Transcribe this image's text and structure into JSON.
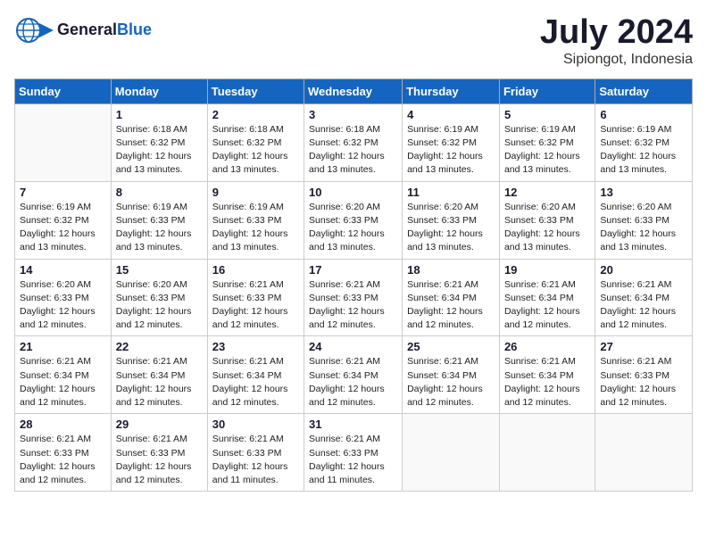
{
  "header": {
    "logo_general": "General",
    "logo_blue": "Blue",
    "month_year": "July 2024",
    "location": "Sipiongot, Indonesia"
  },
  "days_of_week": [
    "Sunday",
    "Monday",
    "Tuesday",
    "Wednesday",
    "Thursday",
    "Friday",
    "Saturday"
  ],
  "weeks": [
    [
      {
        "day": "",
        "info": ""
      },
      {
        "day": "1",
        "info": "Sunrise: 6:18 AM\nSunset: 6:32 PM\nDaylight: 12 hours\nand 13 minutes."
      },
      {
        "day": "2",
        "info": "Sunrise: 6:18 AM\nSunset: 6:32 PM\nDaylight: 12 hours\nand 13 minutes."
      },
      {
        "day": "3",
        "info": "Sunrise: 6:18 AM\nSunset: 6:32 PM\nDaylight: 12 hours\nand 13 minutes."
      },
      {
        "day": "4",
        "info": "Sunrise: 6:19 AM\nSunset: 6:32 PM\nDaylight: 12 hours\nand 13 minutes."
      },
      {
        "day": "5",
        "info": "Sunrise: 6:19 AM\nSunset: 6:32 PM\nDaylight: 12 hours\nand 13 minutes."
      },
      {
        "day": "6",
        "info": "Sunrise: 6:19 AM\nSunset: 6:32 PM\nDaylight: 12 hours\nand 13 minutes."
      }
    ],
    [
      {
        "day": "7",
        "info": "Sunrise: 6:19 AM\nSunset: 6:32 PM\nDaylight: 12 hours\nand 13 minutes."
      },
      {
        "day": "8",
        "info": "Sunrise: 6:19 AM\nSunset: 6:33 PM\nDaylight: 12 hours\nand 13 minutes."
      },
      {
        "day": "9",
        "info": "Sunrise: 6:19 AM\nSunset: 6:33 PM\nDaylight: 12 hours\nand 13 minutes."
      },
      {
        "day": "10",
        "info": "Sunrise: 6:20 AM\nSunset: 6:33 PM\nDaylight: 12 hours\nand 13 minutes."
      },
      {
        "day": "11",
        "info": "Sunrise: 6:20 AM\nSunset: 6:33 PM\nDaylight: 12 hours\nand 13 minutes."
      },
      {
        "day": "12",
        "info": "Sunrise: 6:20 AM\nSunset: 6:33 PM\nDaylight: 12 hours\nand 13 minutes."
      },
      {
        "day": "13",
        "info": "Sunrise: 6:20 AM\nSunset: 6:33 PM\nDaylight: 12 hours\nand 13 minutes."
      }
    ],
    [
      {
        "day": "14",
        "info": "Sunrise: 6:20 AM\nSunset: 6:33 PM\nDaylight: 12 hours\nand 12 minutes."
      },
      {
        "day": "15",
        "info": "Sunrise: 6:20 AM\nSunset: 6:33 PM\nDaylight: 12 hours\nand 12 minutes."
      },
      {
        "day": "16",
        "info": "Sunrise: 6:21 AM\nSunset: 6:33 PM\nDaylight: 12 hours\nand 12 minutes."
      },
      {
        "day": "17",
        "info": "Sunrise: 6:21 AM\nSunset: 6:33 PM\nDaylight: 12 hours\nand 12 minutes."
      },
      {
        "day": "18",
        "info": "Sunrise: 6:21 AM\nSunset: 6:34 PM\nDaylight: 12 hours\nand 12 minutes."
      },
      {
        "day": "19",
        "info": "Sunrise: 6:21 AM\nSunset: 6:34 PM\nDaylight: 12 hours\nand 12 minutes."
      },
      {
        "day": "20",
        "info": "Sunrise: 6:21 AM\nSunset: 6:34 PM\nDaylight: 12 hours\nand 12 minutes."
      }
    ],
    [
      {
        "day": "21",
        "info": "Sunrise: 6:21 AM\nSunset: 6:34 PM\nDaylight: 12 hours\nand 12 minutes."
      },
      {
        "day": "22",
        "info": "Sunrise: 6:21 AM\nSunset: 6:34 PM\nDaylight: 12 hours\nand 12 minutes."
      },
      {
        "day": "23",
        "info": "Sunrise: 6:21 AM\nSunset: 6:34 PM\nDaylight: 12 hours\nand 12 minutes."
      },
      {
        "day": "24",
        "info": "Sunrise: 6:21 AM\nSunset: 6:34 PM\nDaylight: 12 hours\nand 12 minutes."
      },
      {
        "day": "25",
        "info": "Sunrise: 6:21 AM\nSunset: 6:34 PM\nDaylight: 12 hours\nand 12 minutes."
      },
      {
        "day": "26",
        "info": "Sunrise: 6:21 AM\nSunset: 6:34 PM\nDaylight: 12 hours\nand 12 minutes."
      },
      {
        "day": "27",
        "info": "Sunrise: 6:21 AM\nSunset: 6:33 PM\nDaylight: 12 hours\nand 12 minutes."
      }
    ],
    [
      {
        "day": "28",
        "info": "Sunrise: 6:21 AM\nSunset: 6:33 PM\nDaylight: 12 hours\nand 12 minutes."
      },
      {
        "day": "29",
        "info": "Sunrise: 6:21 AM\nSunset: 6:33 PM\nDaylight: 12 hours\nand 12 minutes."
      },
      {
        "day": "30",
        "info": "Sunrise: 6:21 AM\nSunset: 6:33 PM\nDaylight: 12 hours\nand 11 minutes."
      },
      {
        "day": "31",
        "info": "Sunrise: 6:21 AM\nSunset: 6:33 PM\nDaylight: 12 hours\nand 11 minutes."
      },
      {
        "day": "",
        "info": ""
      },
      {
        "day": "",
        "info": ""
      },
      {
        "day": "",
        "info": ""
      }
    ]
  ]
}
